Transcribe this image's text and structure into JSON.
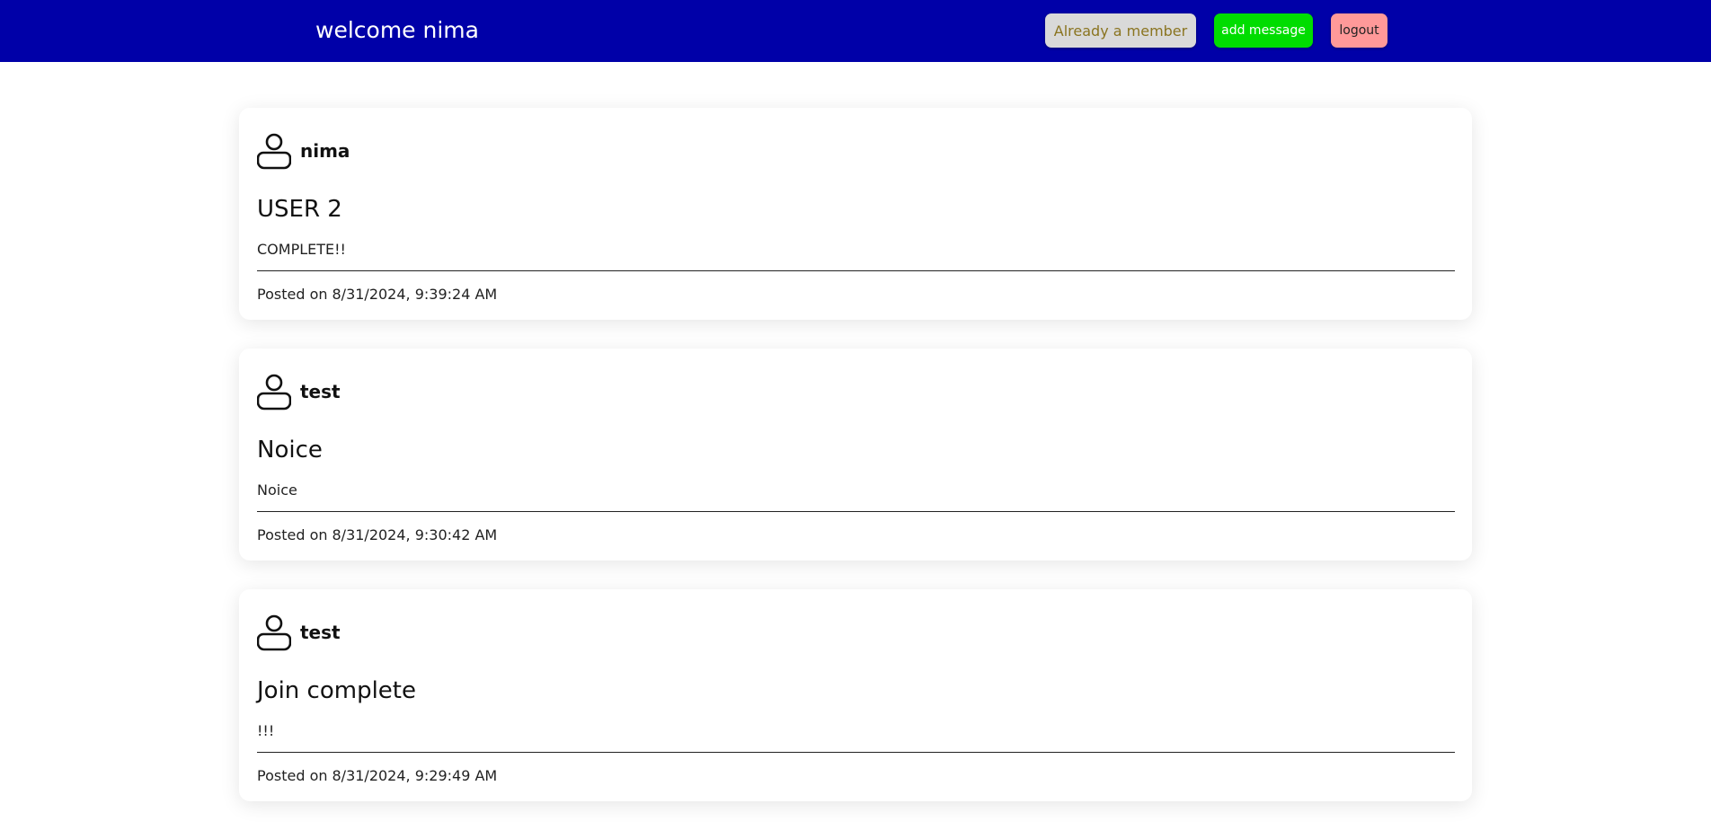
{
  "header": {
    "welcome_text": "welcome nima",
    "buttons": {
      "member_label": "Already a member",
      "add_message_label": "add message",
      "logout_label": "logout"
    }
  },
  "colors": {
    "header_bg": "#0000a8",
    "member_button_bg": "#d9d9d9",
    "add_message_button_bg": "#00dd00",
    "logout_button_bg": "#ff9999"
  },
  "posted_prefix": "Posted on",
  "messages": [
    {
      "author": "nima",
      "author_icon": "user-icon",
      "title": "USER 2",
      "body": "COMPLETE!!",
      "posted_at": "8/31/2024, 9:39:24 AM"
    },
    {
      "author": "test",
      "author_icon": "user-icon",
      "title": "Noice",
      "body": "Noice",
      "posted_at": "8/31/2024, 9:30:42 AM"
    },
    {
      "author": "test",
      "author_icon": "user-icon",
      "title": "Join complete",
      "body": "!!!",
      "posted_at": "8/31/2024, 9:29:49 AM"
    }
  ]
}
